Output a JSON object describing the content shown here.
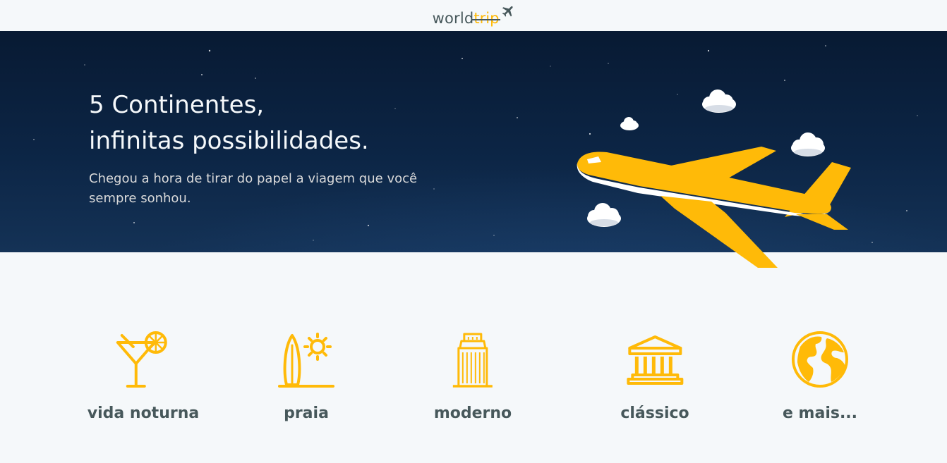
{
  "header": {
    "logo_world": "world",
    "logo_trip": "trip",
    "logo_icon": "airplane-icon"
  },
  "banner": {
    "title_line1": "5 Continentes,",
    "title_line2": "infinitas possibilidades.",
    "subtitle": "Chegou a hora de tirar do papel a viagem que você sempre sonhou.",
    "illustration": "airplane-illustration"
  },
  "categories": [
    {
      "label": "vida noturna",
      "icon": "cocktail-icon"
    },
    {
      "label": "praia",
      "icon": "surf-icon"
    },
    {
      "label": "moderno",
      "icon": "building-icon"
    },
    {
      "label": "clássico",
      "icon": "museum-icon"
    },
    {
      "label": "e mais...",
      "icon": "earth-icon"
    }
  ],
  "colors": {
    "accent": "#FFBA08",
    "text_dark": "#47585B",
    "background": "#F5F8FA",
    "banner_dark": "#0c2545"
  }
}
